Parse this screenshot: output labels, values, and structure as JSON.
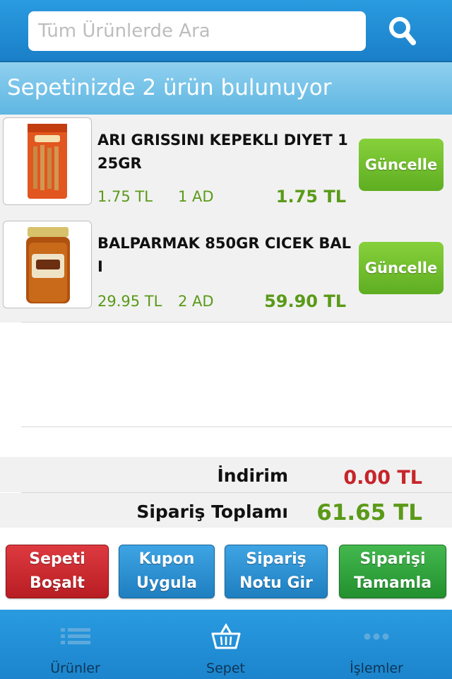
{
  "search": {
    "placeholder": "Tüm Ürünlerde Ara"
  },
  "cart": {
    "header": "Sepetinizde 2 ürün bulunuyor",
    "items": [
      {
        "name": "ARI GRISSINI KEPEKLI DIYET 1 25GR",
        "unit_price": "1.75 TL",
        "quantity": "1 AD",
        "total": "1.75 TL",
        "update_label": "Güncelle"
      },
      {
        "name": "BALPARMAK 850GR CICEK BAL I",
        "unit_price": "29.95 TL",
        "quantity": "2 AD",
        "total": "59.90 TL",
        "update_label": "Güncelle"
      }
    ]
  },
  "summary": {
    "discount_label": "İndirim",
    "discount_value": "0.00 TL",
    "total_label": "Sipariş Toplamı",
    "total_value": "61.65 TL"
  },
  "actions": [
    {
      "line1": "Sepeti",
      "line2": "Boşalt",
      "color": "#c9252b"
    },
    {
      "line1": "Kupon",
      "line2": "Uygula",
      "color": "#2a8fd0"
    },
    {
      "line1": "Sipariş",
      "line2": "Notu Gir",
      "color": "#2a8fd0"
    },
    {
      "line1": "Siparişi",
      "line2": "Tamamla",
      "color": "#2f9f3c"
    }
  ],
  "tabs": [
    {
      "label": "Ürünler",
      "icon": "list-icon"
    },
    {
      "label": "Sepet",
      "icon": "basket-icon"
    },
    {
      "label": "İşlemler",
      "icon": "more-icon"
    }
  ],
  "colors": {
    "accent_blue": "#1a88d0",
    "price_green": "#5a9a18",
    "discount_red": "#c6252b",
    "update_green": "#6cbc2a"
  }
}
